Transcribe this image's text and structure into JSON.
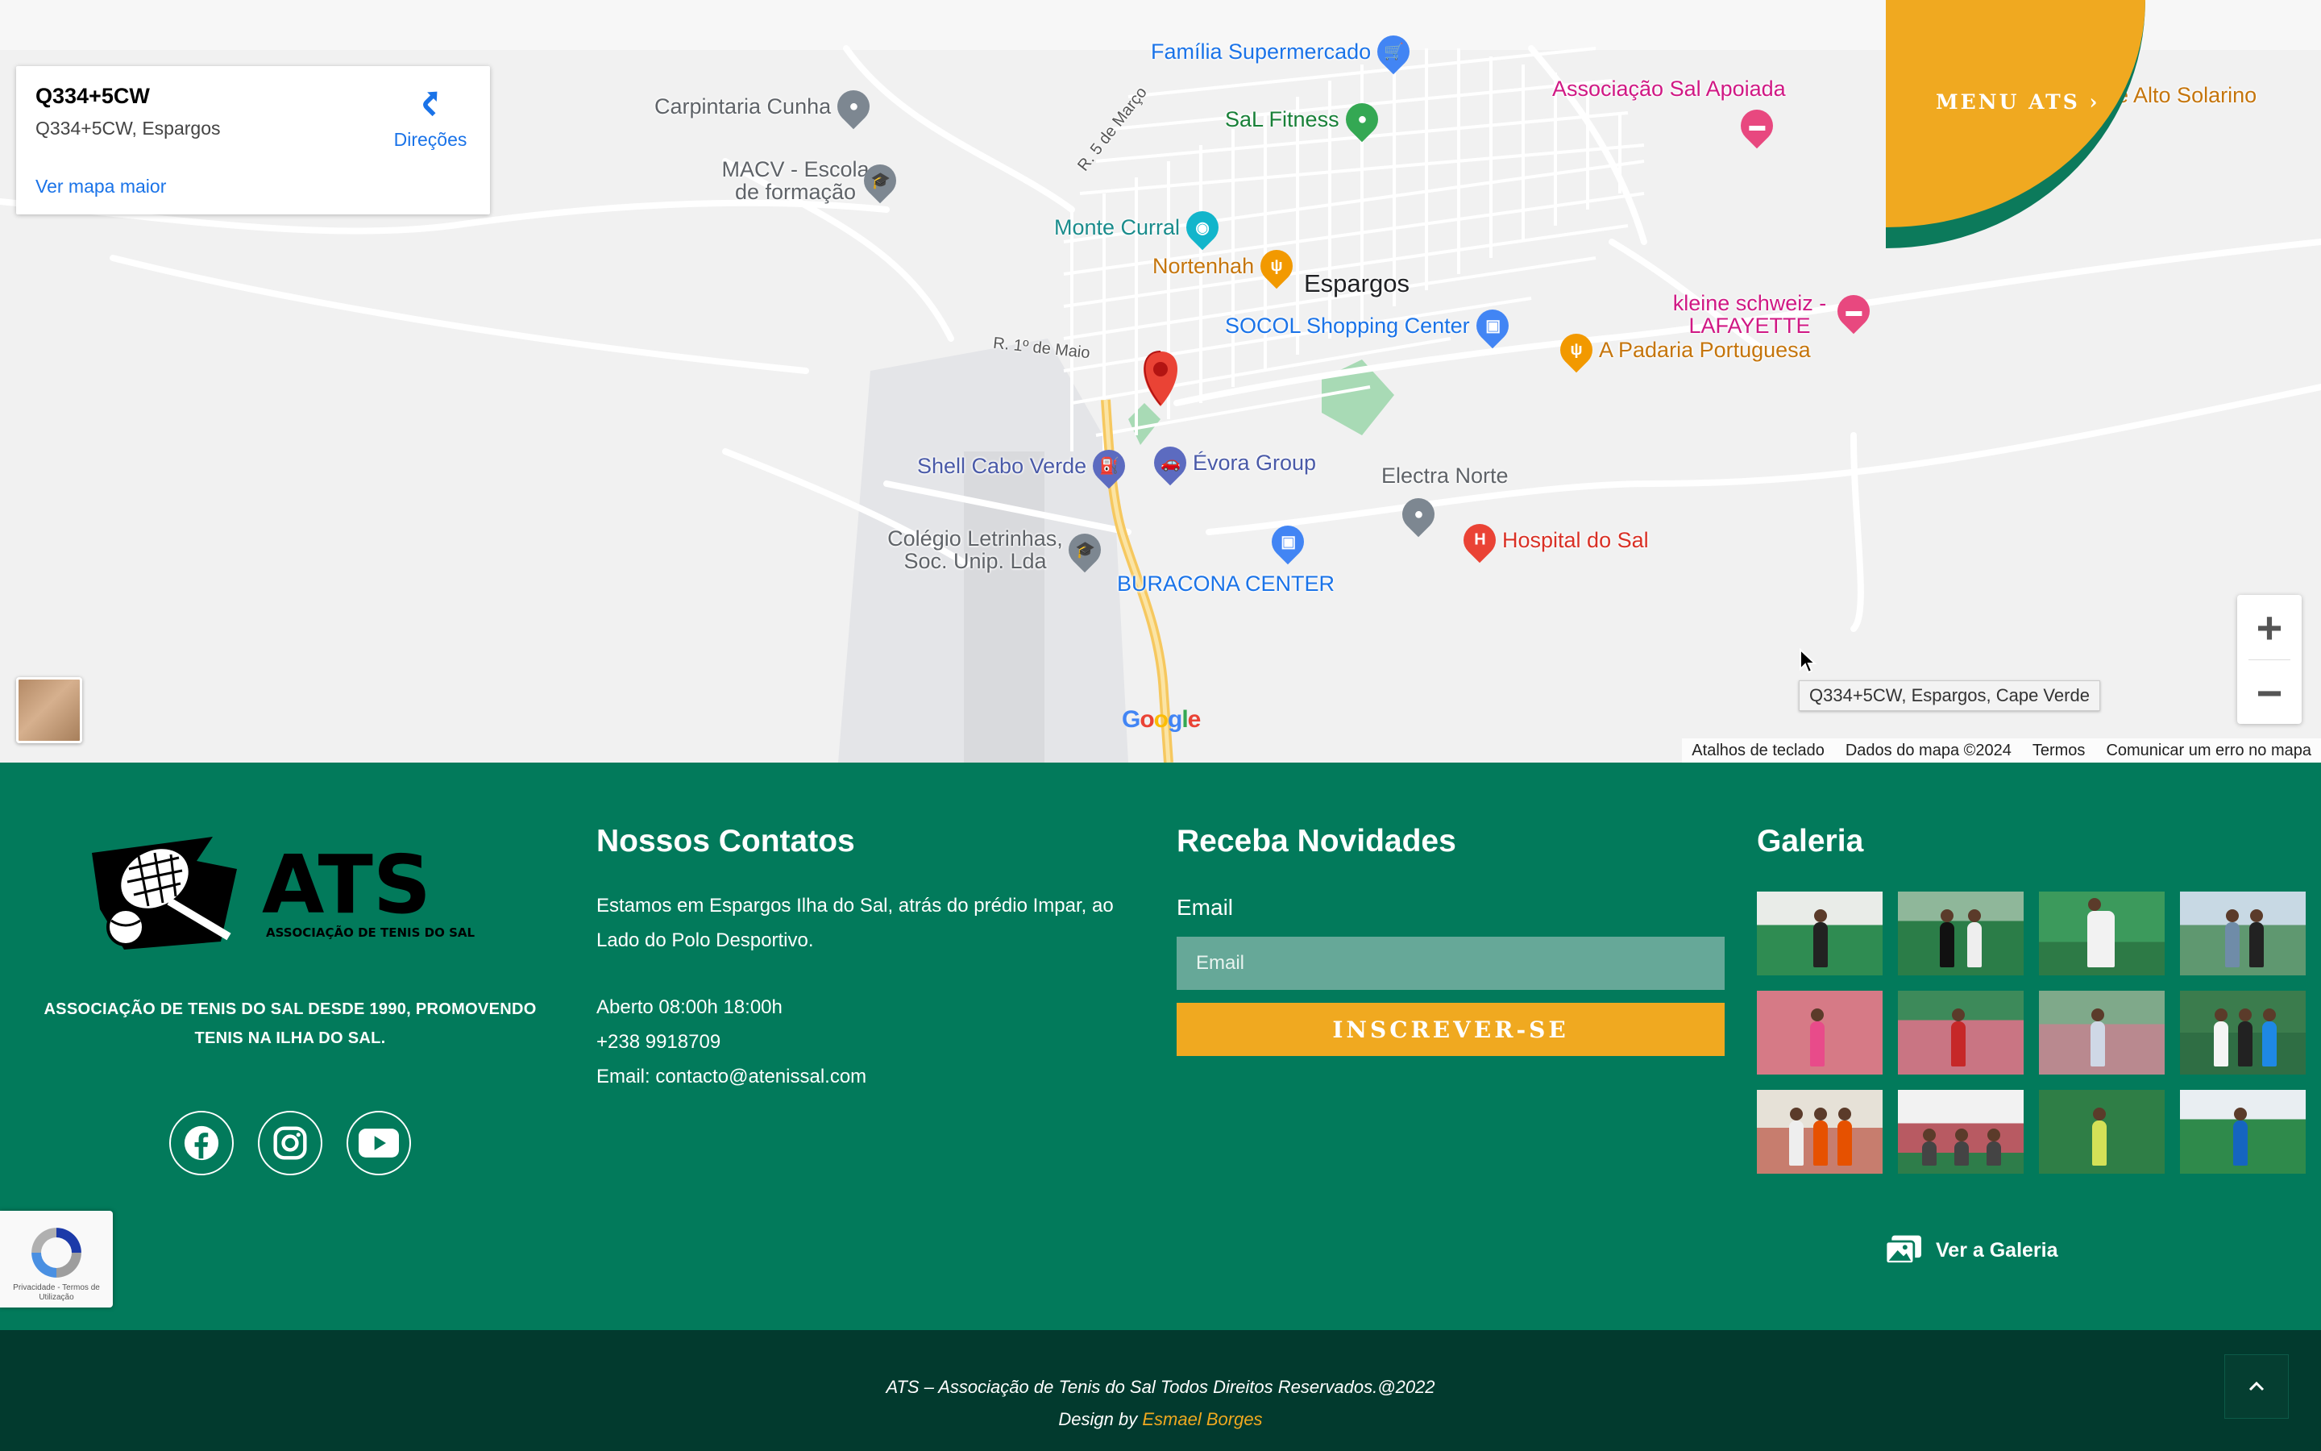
{
  "map": {
    "card": {
      "title": "Q334+5CW",
      "address": "Q334+5CW, Espargos",
      "directions_label": "Direções",
      "bigger_map_label": "Ver mapa maior"
    },
    "places": {
      "familia": "Família Supermercado",
      "carpintaria": "Carpintaria Cunha",
      "macv": "MACV - Escola de formação",
      "sal_fitness": "SaL Fitness",
      "associacao": "Associação Sal Apoiada",
      "alto_solarino": "e Alto Solarino",
      "monte_curral": "Monte Curral",
      "nortenhah": "Nortenhah",
      "espargos": "Espargos",
      "socol": "SOCOL Shopping Center",
      "kleine": "kleine schweiz - LAFAYETTE",
      "padaria": "A Padaria Portuguesa",
      "shell": "Shell Cabo Verde",
      "evora": "Évora Group",
      "electra": "Electra Norte",
      "hospital": "Hospital do Sal",
      "colegio": "Colégio Letrinhas, Soc. Unip. Lda",
      "buracona": "BURACONA CENTER"
    },
    "streets": {
      "r5marco": "R. 5 de Março",
      "r1maio": "R. 1º de Maio"
    },
    "tooltip": "Q334+5CW, Espargos, Cape Verde",
    "google_logo": "Google",
    "attribution": {
      "shortcuts": "Atalhos de teclado",
      "data": "Dados do mapa ©2024",
      "terms": "Termos",
      "report": "Comunicar um erro no mapa"
    },
    "zoom_in": "+",
    "zoom_out": "−"
  },
  "menu": {
    "label": "MENU ATS  ›"
  },
  "footer": {
    "logo_text": "ATS",
    "logo_subtext": "ASSOCIAÇÃO DE TENIS DO SAL",
    "tagline": "ASSOCIAÇÃO DE TENIS DO SAL DESDE 1990, PROMOVENDO TENIS NA ILHA DO SAL.",
    "contacts": {
      "title": "Nossos Contatos",
      "address": "Estamos em Espargos Ilha do Sal, atrás do prédio Impar, ao Lado do Polo Desportivo.",
      "hours": "Aberto 08:00h 18:00h",
      "phone": " +238 9918709",
      "email": "Email: contacto@atenissal.com"
    },
    "newsletter": {
      "title": "Receba Novidades",
      "label": "Email",
      "placeholder": "Email",
      "button": "INSCREVER-SE"
    },
    "gallery": {
      "title": "Galeria",
      "link": "Ver a Galeria"
    },
    "recaptcha": "Privacidade - Termos de Utilização"
  },
  "bottom": {
    "copyright": "ATS – Associação de Tenis do Sal Todos Direitos Reservados.@2022",
    "design_prefix": "Design by ",
    "design_author": "Esmael Borges"
  },
  "colors": {
    "green": "#027a5b",
    "dark_green": "#023a2e",
    "accent": "#f0a920"
  }
}
